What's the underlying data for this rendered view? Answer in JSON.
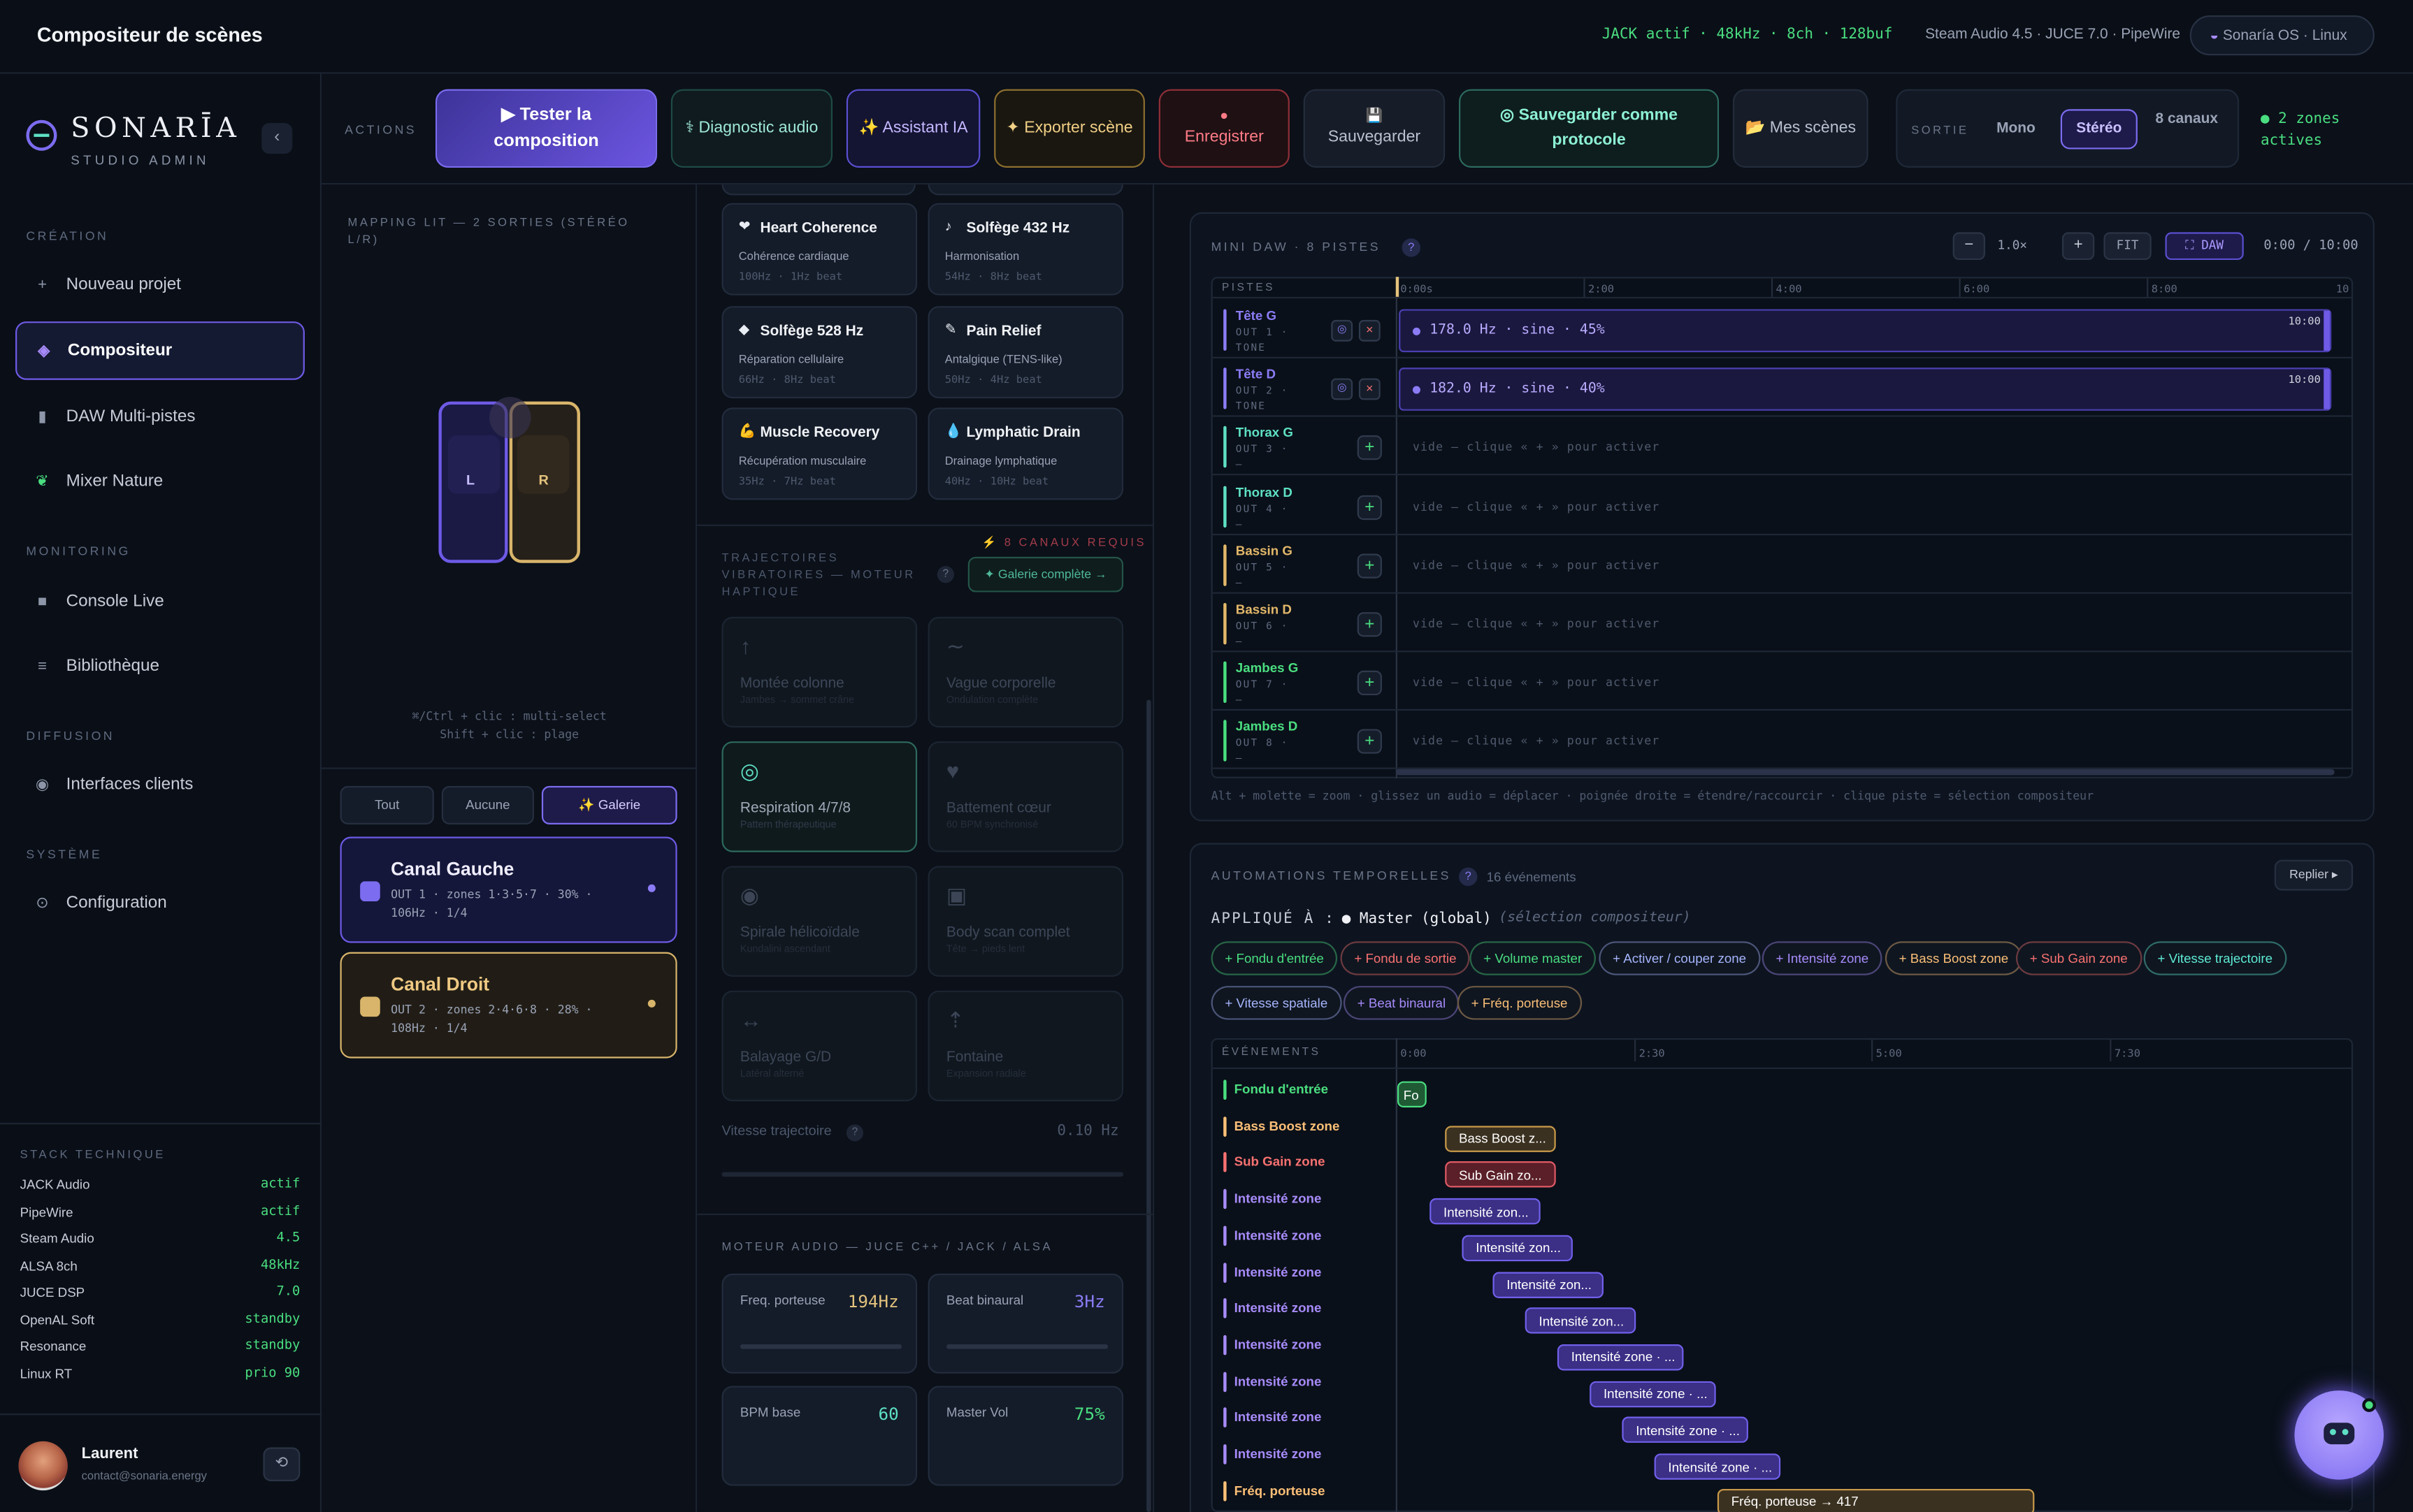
{
  "app": {
    "title": "Compositeur de scènes"
  },
  "status": {
    "jack": "JACK actif · 48kHz · 8ch · 128buf",
    "stack": "Steam Audio 4.5 · JUCE 7.0 · PipeWire",
    "os": "Sonaría OS · Linux"
  },
  "brand": {
    "name": "SONARĪA",
    "sub": "STUDIO ADMIN"
  },
  "sidebar": {
    "sections": [
      "CRÉATION",
      "MONITORING",
      "DIFFUSION",
      "SYSTÈME"
    ],
    "items": [
      {
        "label": "Nouveau projet"
      },
      {
        "label": "Compositeur"
      },
      {
        "label": "DAW Multi-pistes"
      },
      {
        "label": "Mixer Nature"
      },
      {
        "label": "Console Live"
      },
      {
        "label": "Bibliothèque"
      },
      {
        "label": "Interfaces clients"
      },
      {
        "label": "Configuration"
      }
    ],
    "stack_title": "STACK TECHNIQUE",
    "stack": [
      {
        "k": "JACK Audio",
        "v": "actif"
      },
      {
        "k": "PipeWire",
        "v": "actif"
      },
      {
        "k": "Steam Audio",
        "v": "4.5"
      },
      {
        "k": "ALSA 8ch",
        "v": "48kHz"
      },
      {
        "k": "JUCE DSP",
        "v": "7.0"
      },
      {
        "k": "OpenAL Soft",
        "v": "standby"
      },
      {
        "k": "Resonance",
        "v": "standby"
      },
      {
        "k": "Linux RT",
        "v": "prio 90"
      }
    ],
    "user": {
      "name": "Laurent",
      "email": "contact@sonaria.energy"
    }
  },
  "actions": {
    "label": "ACTIONS",
    "test": "▶ Tester la composition",
    "diag": "Diagnostic audio",
    "ia": "✨ Assistant IA",
    "export": "✦ Exporter scène",
    "rec": "Enregistrer",
    "save": "Sauvegarder",
    "proto": "◎ Sauvegarder comme protocole",
    "scenes": "Mes scènes",
    "out_label": "SORTIE",
    "mono": "Mono",
    "stereo": "Stéréo",
    "ch8": "8 canaux",
    "zones": "● 2 zones actives"
  },
  "mapping": {
    "title": "MAPPING LIT — 2 SORTIES (STÉRÉO L/R)",
    "left": "L",
    "right": "R",
    "hint1": "⌘/Ctrl + clic : multi-select",
    "hint2": "Shift + clic : plage",
    "filters": [
      "Tout",
      "Aucune",
      "✨ Galerie"
    ]
  },
  "channels": [
    {
      "name": "Canal Gauche",
      "meta": "OUT 1 · zones 1·3·5·7 · 30% · 106Hz · 1/4"
    },
    {
      "name": "Canal Droit",
      "meta": "OUT 2 · zones 2·4·6·8 · 28% · 108Hz · 1/4"
    }
  ],
  "presets": [
    {
      "icon": "❤",
      "name": "Heart Coherence",
      "desc": "Cohérence cardiaque",
      "freq": "100Hz · 1Hz beat"
    },
    {
      "icon": "♪",
      "name": "Solfège 432 Hz",
      "desc": "Harmonisation",
      "freq": "54Hz · 8Hz beat"
    },
    {
      "icon": "◆",
      "name": "Solfège 528 Hz",
      "desc": "Réparation cellulaire",
      "freq": "66Hz · 8Hz beat"
    },
    {
      "icon": "✎",
      "name": "Pain Relief",
      "desc": "Antalgique (TENS-like)",
      "freq": "50Hz · 4Hz beat"
    },
    {
      "icon": "💪",
      "name": "Muscle Recovery",
      "desc": "Récupération musculaire",
      "freq": "35Hz · 7Hz beat"
    },
    {
      "icon": "💧",
      "name": "Lymphatic Drain",
      "desc": "Drainage lymphatique",
      "freq": "40Hz · 10Hz beat"
    }
  ],
  "traj": {
    "title": "TRAJECTOIRES VIBRATOIRES — MOTEUR HAPTIQUE",
    "req": "⚡ 8 CANAUX REQUIS",
    "gallery": "✦ Galerie complète →",
    "speed_label": "Vitesse trajectoire",
    "speed": "0.10 Hz",
    "items": [
      {
        "icon": "↑",
        "name": "Montée colonne",
        "desc": "Jambes → sommet crâne"
      },
      {
        "icon": "∼",
        "name": "Vague corporelle",
        "desc": "Ondulation complète"
      },
      {
        "icon": "◎",
        "name": "Respiration 4/7/8",
        "desc": "Pattern thérapeutique"
      },
      {
        "icon": "♥",
        "name": "Battement cœur",
        "desc": "60 BPM synchronisé"
      },
      {
        "icon": "◉",
        "name": "Spirale hélicoïdale",
        "desc": "Kundalini ascendant"
      },
      {
        "icon": "▣",
        "name": "Body scan complet",
        "desc": "Tête → pieds lent"
      },
      {
        "icon": "↔",
        "name": "Balayage G/D",
        "desc": "Latéral alterné"
      },
      {
        "icon": "⇡",
        "name": "Fontaine",
        "desc": "Expansion radiale"
      }
    ]
  },
  "engine": {
    "title": "MOTEUR AUDIO — JUCE C++ / JACK / ALSA",
    "carrier_l": "Freq. porteuse",
    "carrier": "194Hz",
    "beat_l": "Beat binaural",
    "beat": "3Hz",
    "bpm_l": "BPM base",
    "bpm": "60",
    "vol_l": "Master Vol",
    "vol": "75%"
  },
  "daw": {
    "title": "MINI DAW · 8 PISTES",
    "zoom": "1.0×",
    "fit": "FIT",
    "daw_btn": "⛶ DAW",
    "time": "0:00 / 10:00",
    "col": "PISTES",
    "ticks": [
      "0:00s",
      "2:00",
      "4:00",
      "6:00",
      "8:00",
      "10"
    ],
    "tracks": [
      {
        "name": "Tête G",
        "sub": "OUT 1 · TONE",
        "clip": "178.0 Hz · sine · 45%",
        "end": "10:00",
        "color": "#8b7cf6"
      },
      {
        "name": "Tête D",
        "sub": "OUT 2 · TONE",
        "clip": "182.0 Hz · sine · 40%",
        "end": "10:00",
        "color": "#8b7cf6"
      },
      {
        "name": "Thorax G",
        "sub": "OUT 3 · —",
        "empty": "vide — clique « + » pour activer",
        "color": "#5ee0c4"
      },
      {
        "name": "Thorax D",
        "sub": "OUT 4 · —",
        "empty": "vide — clique « + » pour activer",
        "color": "#5ee0c4"
      },
      {
        "name": "Bassin G",
        "sub": "OUT 5 · —",
        "empty": "vide — clique « + » pour activer",
        "color": "#e3b86a"
      },
      {
        "name": "Bassin D",
        "sub": "OUT 6 · —",
        "empty": "vide — clique « + » pour activer",
        "color": "#e3b86a"
      },
      {
        "name": "Jambes G",
        "sub": "OUT 7 · —",
        "empty": "vide — clique « + » pour activer",
        "color": "#4ade80"
      },
      {
        "name": "Jambes D",
        "sub": "OUT 8 · —",
        "empty": "vide — clique « + » pour activer",
        "color": "#4ade80"
      }
    ],
    "hint": "Alt + molette = zoom · glissez un audio = déplacer · poignée droite = étendre/raccourcir · clique piste = sélection compositeur"
  },
  "autom": {
    "title": "AUTOMATIONS TEMPORELLES",
    "count": "16 événements",
    "fold": "Replier ▸",
    "applied": "APPLIQUÉ À :",
    "target": "● Master (global)",
    "sel": "(sélection compositeur)",
    "chips": [
      {
        "label": "+ Fondu d'entrée",
        "color": "#4ade80"
      },
      {
        "label": "+ Fondu de sortie",
        "color": "#f87171"
      },
      {
        "label": "+ Volume master",
        "color": "#4ade80"
      },
      {
        "label": "+ Activer / couper zone",
        "color": "#a5b4fc"
      },
      {
        "label": "+ Intensité zone",
        "color": "#a78bfa"
      },
      {
        "label": "+ Bass Boost zone",
        "color": "#fbbf77"
      },
      {
        "label": "+ Sub Gain zone",
        "color": "#f87171"
      },
      {
        "label": "+ Vitesse trajectoire",
        "color": "#5eead4"
      },
      {
        "label": "+ Vitesse spatiale",
        "color": "#a5b4fc"
      },
      {
        "label": "+ Beat binaural",
        "color": "#a78bfa"
      },
      {
        "label": "+ Fréq. porteuse",
        "color": "#fbbf77"
      }
    ],
    "col": "ÉVÉNEMENTS",
    "ticks": [
      "0:00",
      "2:30",
      "5:00",
      "7:30"
    ],
    "events": [
      {
        "name": "Fondu d'entrée",
        "bar": "Fo",
        "color": "#4ade80"
      },
      {
        "name": "Bass Boost zone",
        "bar": "Bass Boost z...",
        "color": "#fbbf77"
      },
      {
        "name": "Sub Gain zone",
        "bar": "Sub Gain zo...",
        "color": "#f87171"
      },
      {
        "name": "Intensité zone",
        "bar": "Intensité zon...",
        "color": "#a78bfa"
      },
      {
        "name": "Intensité zone",
        "bar": "Intensité zon...",
        "color": "#a78bfa"
      },
      {
        "name": "Intensité zone",
        "bar": "Intensité zon...",
        "color": "#a78bfa"
      },
      {
        "name": "Intensité zone",
        "bar": "Intensité zon...",
        "color": "#a78bfa"
      },
      {
        "name": "Intensité zone",
        "bar": "Intensité zone · ...",
        "color": "#a78bfa"
      },
      {
        "name": "Intensité zone",
        "bar": "Intensité zone · ...",
        "color": "#a78bfa"
      },
      {
        "name": "Intensité zone",
        "bar": "Intensité zone · ...",
        "color": "#a78bfa"
      },
      {
        "name": "Intensité zone",
        "bar": "Intensité zone · ...",
        "color": "#a78bfa"
      },
      {
        "name": "Fréq. porteuse",
        "bar": "Fréq. porteuse → 417",
        "color": "#fbbf77"
      }
    ]
  }
}
